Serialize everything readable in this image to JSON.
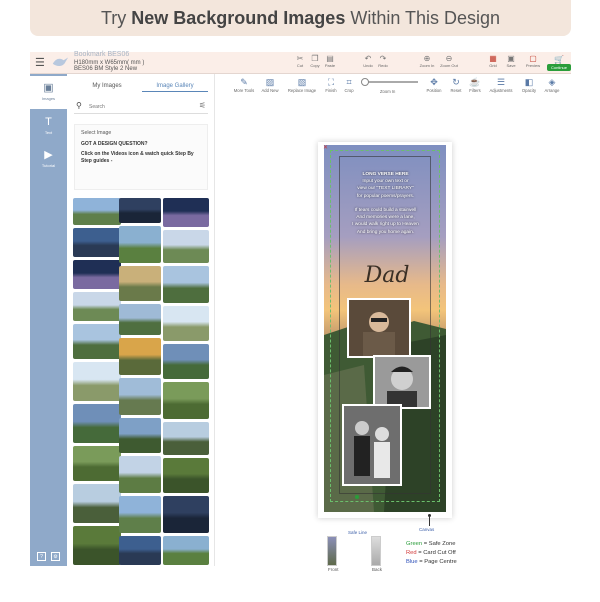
{
  "banner": {
    "prefix": "Try ",
    "bold": "New Background Images",
    "suffix": " Within This Design"
  },
  "header": {
    "menu_icon": "hamburger-icon",
    "doc_name": "Bookmark BES06",
    "doc_size": "H180mm x W65mm( mm )",
    "doc_style": "BES06 BM Style 2 New",
    "tools": [
      {
        "label": "Cut",
        "icon": "scissors-icon"
      },
      {
        "label": "Copy",
        "icon": "copy-icon"
      },
      {
        "label": "Paste",
        "icon": "paste-icon"
      },
      {
        "label": "Undo",
        "icon": "undo-icon"
      },
      {
        "label": "Redo",
        "icon": "redo-icon"
      },
      {
        "label": "Zoom In",
        "icon": "zoom-in-icon"
      },
      {
        "label": "Zoom Out",
        "icon": "zoom-out-icon"
      },
      {
        "label": "Grid",
        "icon": "grid-icon"
      },
      {
        "label": "Save",
        "icon": "save-icon"
      },
      {
        "label": "Preview",
        "icon": "preview-icon"
      }
    ],
    "continue_label": "Continue"
  },
  "rail": {
    "items": [
      {
        "label": "Images",
        "icon": "images-icon",
        "active": true
      },
      {
        "label": "Text",
        "icon": "text-icon",
        "active": false
      },
      {
        "label": "Tutorial",
        "icon": "tutorial-icon",
        "active": false
      }
    ],
    "bottom": [
      "?",
      "⚙"
    ]
  },
  "panel": {
    "tabs": [
      "My Images",
      "Image Gallery"
    ],
    "active_tab": "Image Gallery",
    "search_placeholder": "Search",
    "select_label": "Select Image",
    "question": "GOT A DESIGN QUESTION?",
    "tip": "Click on the Videos icon & watch quick Step By Step guides -"
  },
  "toolbar": {
    "items": [
      {
        "label": "More Tools",
        "icon": "more-tools-icon"
      },
      {
        "label": "Add New",
        "icon": "add-image-icon"
      },
      {
        "label": "Replace Image",
        "icon": "replace-image-icon"
      },
      {
        "label": "Finish",
        "icon": "finish-icon"
      },
      {
        "label": "Crop",
        "icon": "crop-icon"
      },
      {
        "label": "Position",
        "icon": "position-icon"
      },
      {
        "label": "Reset",
        "icon": "reset-icon"
      },
      {
        "label": "Filters",
        "icon": "filters-icon"
      },
      {
        "label": "Adjustments",
        "icon": "adjustments-icon"
      },
      {
        "label": "Opacity",
        "icon": "opacity-icon"
      },
      {
        "label": "Arrange",
        "icon": "arrange-icon"
      }
    ],
    "zoom_label": "Zoom In"
  },
  "design": {
    "verse": [
      "LONG VERSE HERE",
      "Input your own text or",
      "view our \"TEXT LIBRARY\"",
      "for popular poems/prayers.",
      "",
      "If tears could build a stairwell",
      "And memories were a lane,",
      "I would walk right up to Heaven",
      "And bring you home again."
    ],
    "name": "Dad"
  },
  "footer": {
    "safe_line": "Safe Line",
    "canvas": "Canvas",
    "front": "Front",
    "back": "Back",
    "legend": [
      {
        "color_word": "Green",
        "meaning": " = Safe Zone",
        "color": "#2a9d3a"
      },
      {
        "color_word": "Red",
        "meaning": " = Card Cut Off",
        "color": "#d23a3a"
      },
      {
        "color_word": "Blue",
        "meaning": " = Page Centre",
        "color": "#2d4fb8"
      }
    ]
  }
}
